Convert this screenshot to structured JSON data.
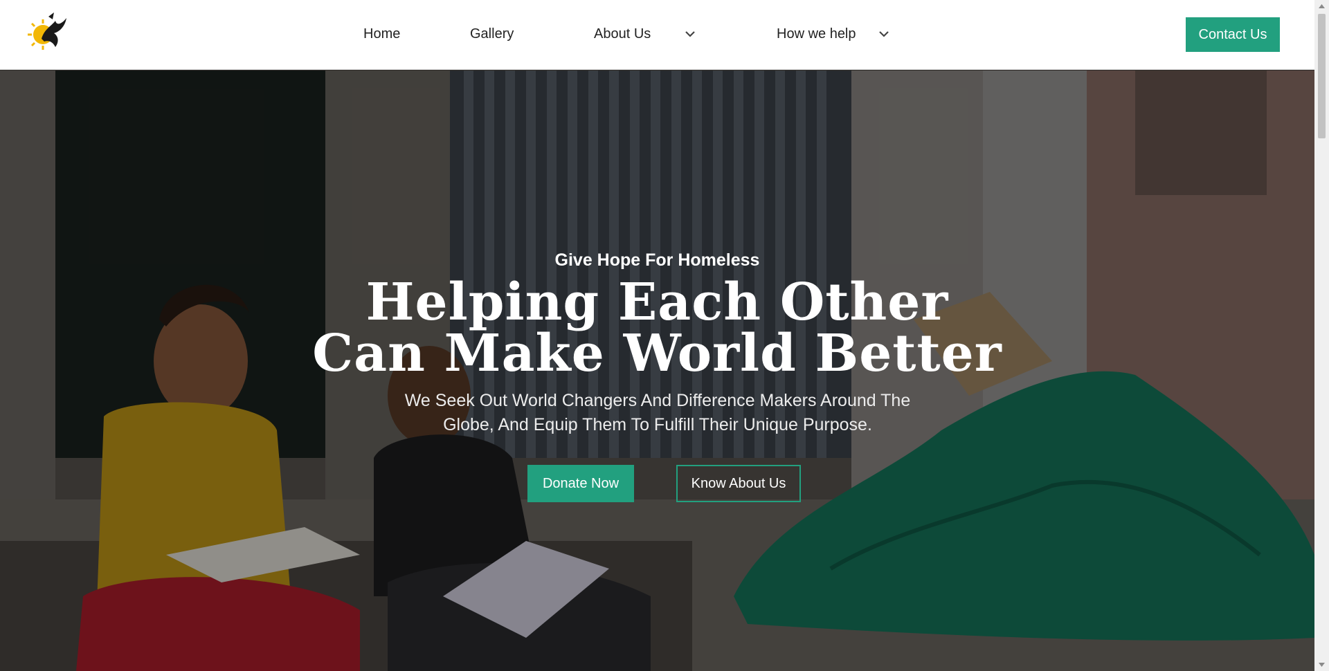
{
  "header": {
    "logo_icon": "bird-sun-logo",
    "nav": [
      {
        "label": "Home"
      },
      {
        "label": "Gallery"
      },
      {
        "label": "About Us",
        "has_dropdown": true
      },
      {
        "label": "How we help",
        "has_dropdown": true
      }
    ],
    "contact_label": "Contact Us"
  },
  "hero": {
    "eyebrow": "Give Hope For Homeless",
    "headline_line1": "Helping Each Other",
    "headline_line2": "Can Make World Better",
    "subtext_line1": "We Seek Out World Changers And Difference Makers Around The",
    "subtext_line2": "Globe, And Equip Them To Fulfill Their Unique Purpose.",
    "donate_label": "Donate Now",
    "know_label": "Know About Us",
    "background_image": "children-reading-on-street-photo"
  },
  "colors": {
    "accent": "#22a07f",
    "header_bg": "#ffffff",
    "nav_text": "#222222"
  }
}
